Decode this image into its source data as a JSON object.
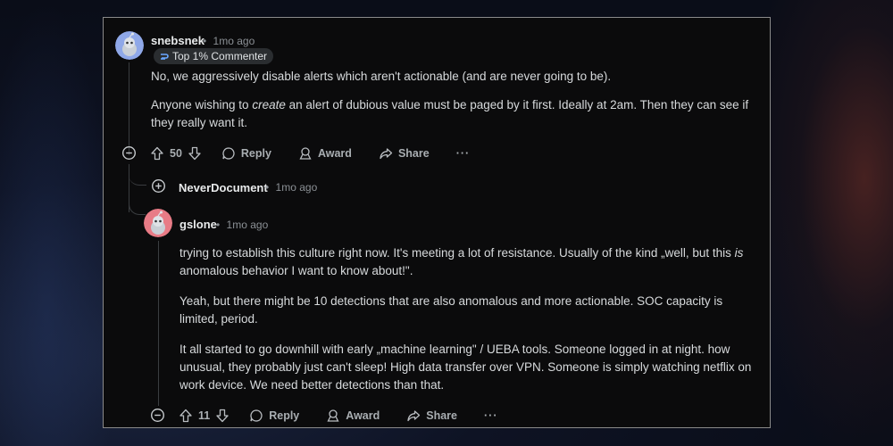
{
  "comments": [
    {
      "user": "snebsnek",
      "time": "1mo ago",
      "flair": "Top 1% Commenter",
      "paragraphs": [
        "No, we aggressively disable alerts which aren't actionable (and are never going to be).",
        "Anyone wishing to create an alert of dubious value must be paged by it first. Ideally at 2am. Then they can see if they really want it."
      ],
      "votes": "50",
      "reply_label": "Reply",
      "award_label": "Award",
      "share_label": "Share",
      "more_label": "···"
    },
    {
      "user": "NeverDocument",
      "time": "1mo ago",
      "collapsed": true
    },
    {
      "user": "gslone",
      "time": "1mo ago",
      "paragraphs": [
        "trying to establish this culture right now. It's meeting a lot of resistance. Usually of the kind „well, but this is anomalous behavior I want to know about!\".",
        "Yeah, but there might be 10 detections that are also anomalous and more actionable. SOC capacity is limited, period.",
        "It all started to go downhill with early „machine learning\" / UEBA tools. Someone logged in at night. how unusual, they probably just can't sleep! High data transfer over VPN. Someone is simply watching netflix on work device. We need better detections than that."
      ],
      "votes": "11",
      "reply_label": "Reply",
      "award_label": "Award",
      "share_label": "Share",
      "more_label": "···"
    }
  ],
  "separator": "•",
  "colors": {
    "accent_avatar_1": "#8fa8e8",
    "accent_avatar_3": "#e87b86",
    "panel_bg": "#0b0b0c"
  }
}
